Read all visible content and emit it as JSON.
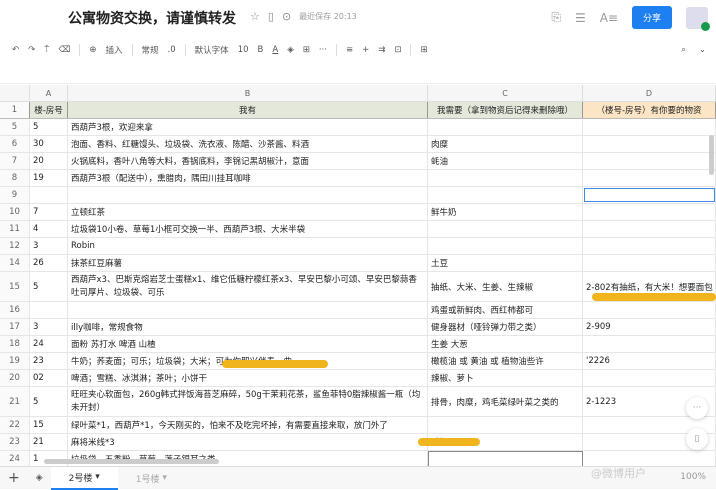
{
  "header": {
    "title": "公寓物资交换，请谨慎转发",
    "saved": "最近保存 20:13",
    "share": "分享"
  },
  "toolbar": {
    "insert": "插入",
    "format": "常规",
    "decimal": ".0",
    "font": "默认字体",
    "size": "10",
    "bold": "B",
    "more": "···"
  },
  "columns": [
    "A",
    "B",
    "C",
    "D"
  ],
  "header_row": {
    "num": "1",
    "A": "楼-房号",
    "B": "我有",
    "C": "我需要（拿到物资后记得来删除哦）",
    "D": "（楼号-房号）有你要的物资"
  },
  "rows": [
    {
      "n": "5",
      "A": "5",
      "B": "西葫芦3根，欢迎来拿",
      "C": "",
      "D": ""
    },
    {
      "n": "6",
      "A": "30",
      "B": "泡面、香料、红糖馒头、垃圾袋、洗衣液、陈醋、沙茶酱、料酒",
      "C": "肉糜",
      "D": ""
    },
    {
      "n": "7",
      "A": "20",
      "B": "火锅底料，香叶八角等大料，香锅底料，李锦记黑胡椒汁，意面",
      "C": "蚝油",
      "D": ""
    },
    {
      "n": "8",
      "A": "19",
      "B": "西葫芦3根（配送中），熏腊肉，隅田川挂耳咖啡",
      "C": "",
      "D": ""
    },
    {
      "n": "9",
      "A": "",
      "B": "",
      "C": "",
      "D": ""
    },
    {
      "n": "10",
      "A": "7",
      "B": "立顿红茶",
      "C": "鲜牛奶",
      "D": ""
    },
    {
      "n": "11",
      "A": "4",
      "B": "垃圾袋10小卷、草莓1小框可交换一半、西葫芦3根、大米半袋",
      "C": "",
      "D": ""
    },
    {
      "n": "12",
      "A": "3",
      "B": "Robin",
      "C": "",
      "D": ""
    },
    {
      "n": "14",
      "A": "26",
      "B": "抹茶红豆麻薯",
      "C": "土豆",
      "D": ""
    },
    {
      "n": "15",
      "A": "5",
      "B": "西葫芦x3、巴斯克熔岩芝士蛋糕x1、维它低糖柠檬红茶x3、早安巴黎小可颂、早安巴黎蒜香吐司厚片、垃圾袋、可乐",
      "C": "抽纸、大米、生姜、生辣椒",
      "D": "2-802有抽纸，有大米！想要面包"
    },
    {
      "n": "16",
      "A": "",
      "B": "",
      "C": "鸡蛋或新鲜肉、西红柿都可",
      "D": ""
    },
    {
      "n": "17",
      "A": "3",
      "B": "illy咖啡，常规食物",
      "C": "健身器材（哑铃弹力带之类）",
      "D": "2-909"
    },
    {
      "n": "18",
      "A": "24",
      "B": "面粉 苏打水 啤酒 山楂",
      "C": "生姜 大葱",
      "D": ""
    },
    {
      "n": "19",
      "A": "23",
      "B": "牛奶；荞麦面；可乐；垃圾袋；大米；可为你即兴伴奏一曲",
      "C": "橄榄油 或 黄油 或 植物油些许",
      "D": "'2226"
    },
    {
      "n": "20",
      "A": "02",
      "B": "啤酒；雪糕、冰淇淋；茶叶；小饼干",
      "C": "辣椒、萝卜",
      "D": ""
    },
    {
      "n": "21",
      "A": "5",
      "B": "旺旺夹心软面包，260g韩式拌饭海苔芝麻碎，50g干茉莉花茶，鲨鱼菲特0脂辣椒酱一瓶（均未开封）",
      "C": "排骨，肉糜，鸡毛菜绿叶菜之类的",
      "D": "2-1223"
    },
    {
      "n": "22",
      "A": "15",
      "B": "绿叶菜*1，西葫芦*1，今天刚买的，怕来不及吃完坏掉，有需要直接来取，放门外了",
      "C": "",
      "D": ""
    },
    {
      "n": "23",
      "A": "21",
      "B": "麻将米线*3",
      "C": "减肥",
      "D": ""
    },
    {
      "n": "24",
      "A": "1",
      "B": "垃圾袋，五香粉，草莓，莲子银耳之类",
      "C": "",
      "D": ""
    }
  ],
  "tabs": [
    "2号楼",
    "1号楼"
  ],
  "zoom": "100%",
  "watermark": "@微博用户"
}
